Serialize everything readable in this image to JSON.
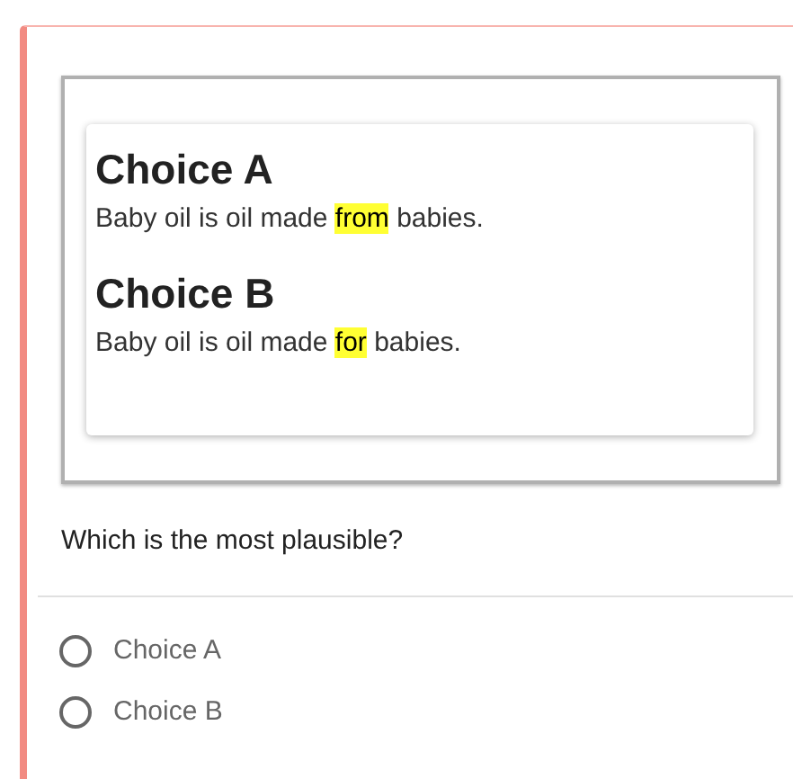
{
  "passage": [
    {
      "title": "Choice A",
      "before": "Baby oil is oil made ",
      "highlight": "from",
      "after": " babies."
    },
    {
      "title": "Choice B",
      "before": "Baby oil is oil made ",
      "highlight": "for",
      "after": " babies."
    }
  ],
  "question": "Which is the most plausible?",
  "options": [
    {
      "label": "Choice A",
      "selected": false
    },
    {
      "label": "Choice B",
      "selected": false
    }
  ]
}
